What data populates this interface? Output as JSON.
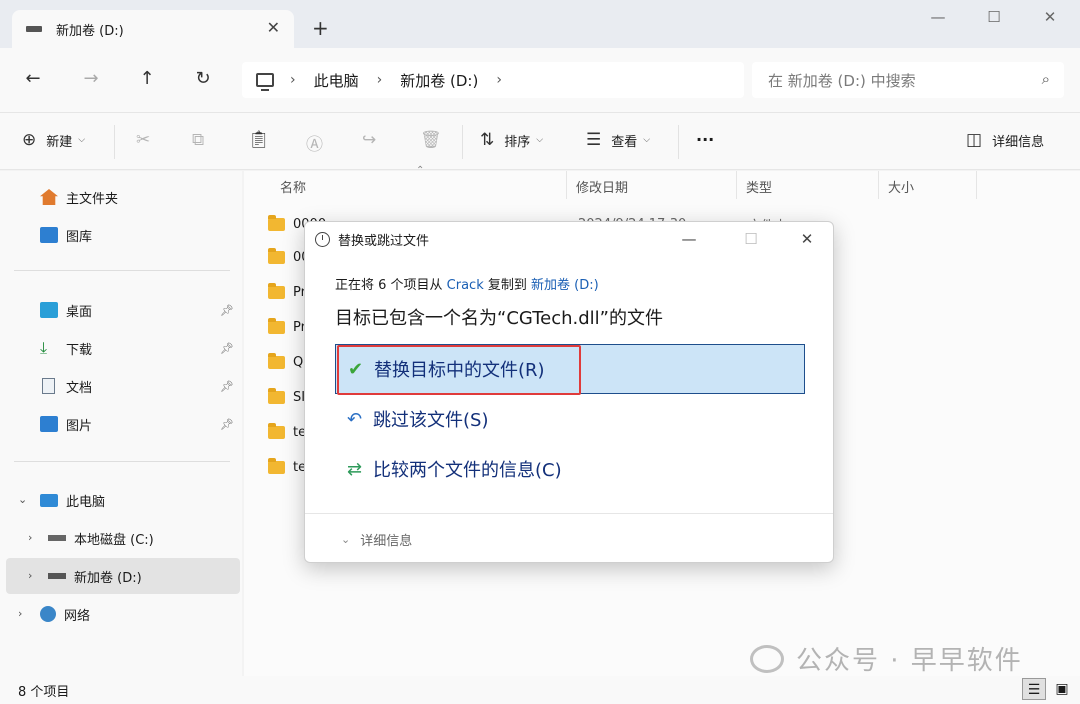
{
  "tab": {
    "title": "新加卷 (D:)",
    "close": "✕",
    "new_tab": "+"
  },
  "window_controls": {
    "minimize": "—",
    "maximize": "☐",
    "close": "✕"
  },
  "nav": {
    "back": "←",
    "forward": "→",
    "up": "↑",
    "refresh": "↻"
  },
  "address": {
    "segments": [
      "此电脑",
      "新加卷 (D:)"
    ],
    "chevron": "›"
  },
  "search": {
    "placeholder": "在 新加卷 (D:) 中搜索"
  },
  "toolbar": {
    "new_label": "新建",
    "sort_label": "排序",
    "view_label": "查看",
    "more": "···",
    "details_label": "详细信息"
  },
  "sidebar": {
    "home": "主文件夹",
    "gallery": "图库",
    "desktop": "桌面",
    "downloads": "下载",
    "documents": "文档",
    "pictures": "图片",
    "this_pc": "此电脑",
    "local_c": "本地磁盘 (C:)",
    "new_d": "新加卷 (D:)",
    "network": "网络"
  },
  "columns": {
    "name": "名称",
    "modified": "修改日期",
    "type": "类型",
    "size": "大小"
  },
  "files": [
    {
      "name": "0000",
      "date": "2024/9/24 17:30",
      "type": "文件夹"
    },
    {
      "name": "00"
    },
    {
      "name": "Pr"
    },
    {
      "name": "Pr"
    },
    {
      "name": "Q"
    },
    {
      "name": "SI"
    },
    {
      "name": "te"
    },
    {
      "name": "te"
    }
  ],
  "status": {
    "count": "8 个项目"
  },
  "dialog": {
    "title": "替换或跳过文件",
    "line1_prefix": "正在将 6 个项目从 ",
    "source": "Crack",
    "line1_mid": " 复制到 ",
    "destination": "新加卷 (D:)",
    "line2": "目标已包含一个名为“CGTech.dll”的文件",
    "replace": "替换目标中的文件(R)",
    "skip": "跳过该文件(S)",
    "compare": "比较两个文件的信息(C)",
    "details": "详细信息"
  },
  "watermark": {
    "text": "公众号 · 早早软件"
  },
  "colors": {
    "accent": "#1a5fb4",
    "highlight": "#cce4f7",
    "annotation": "#e03b3b"
  }
}
